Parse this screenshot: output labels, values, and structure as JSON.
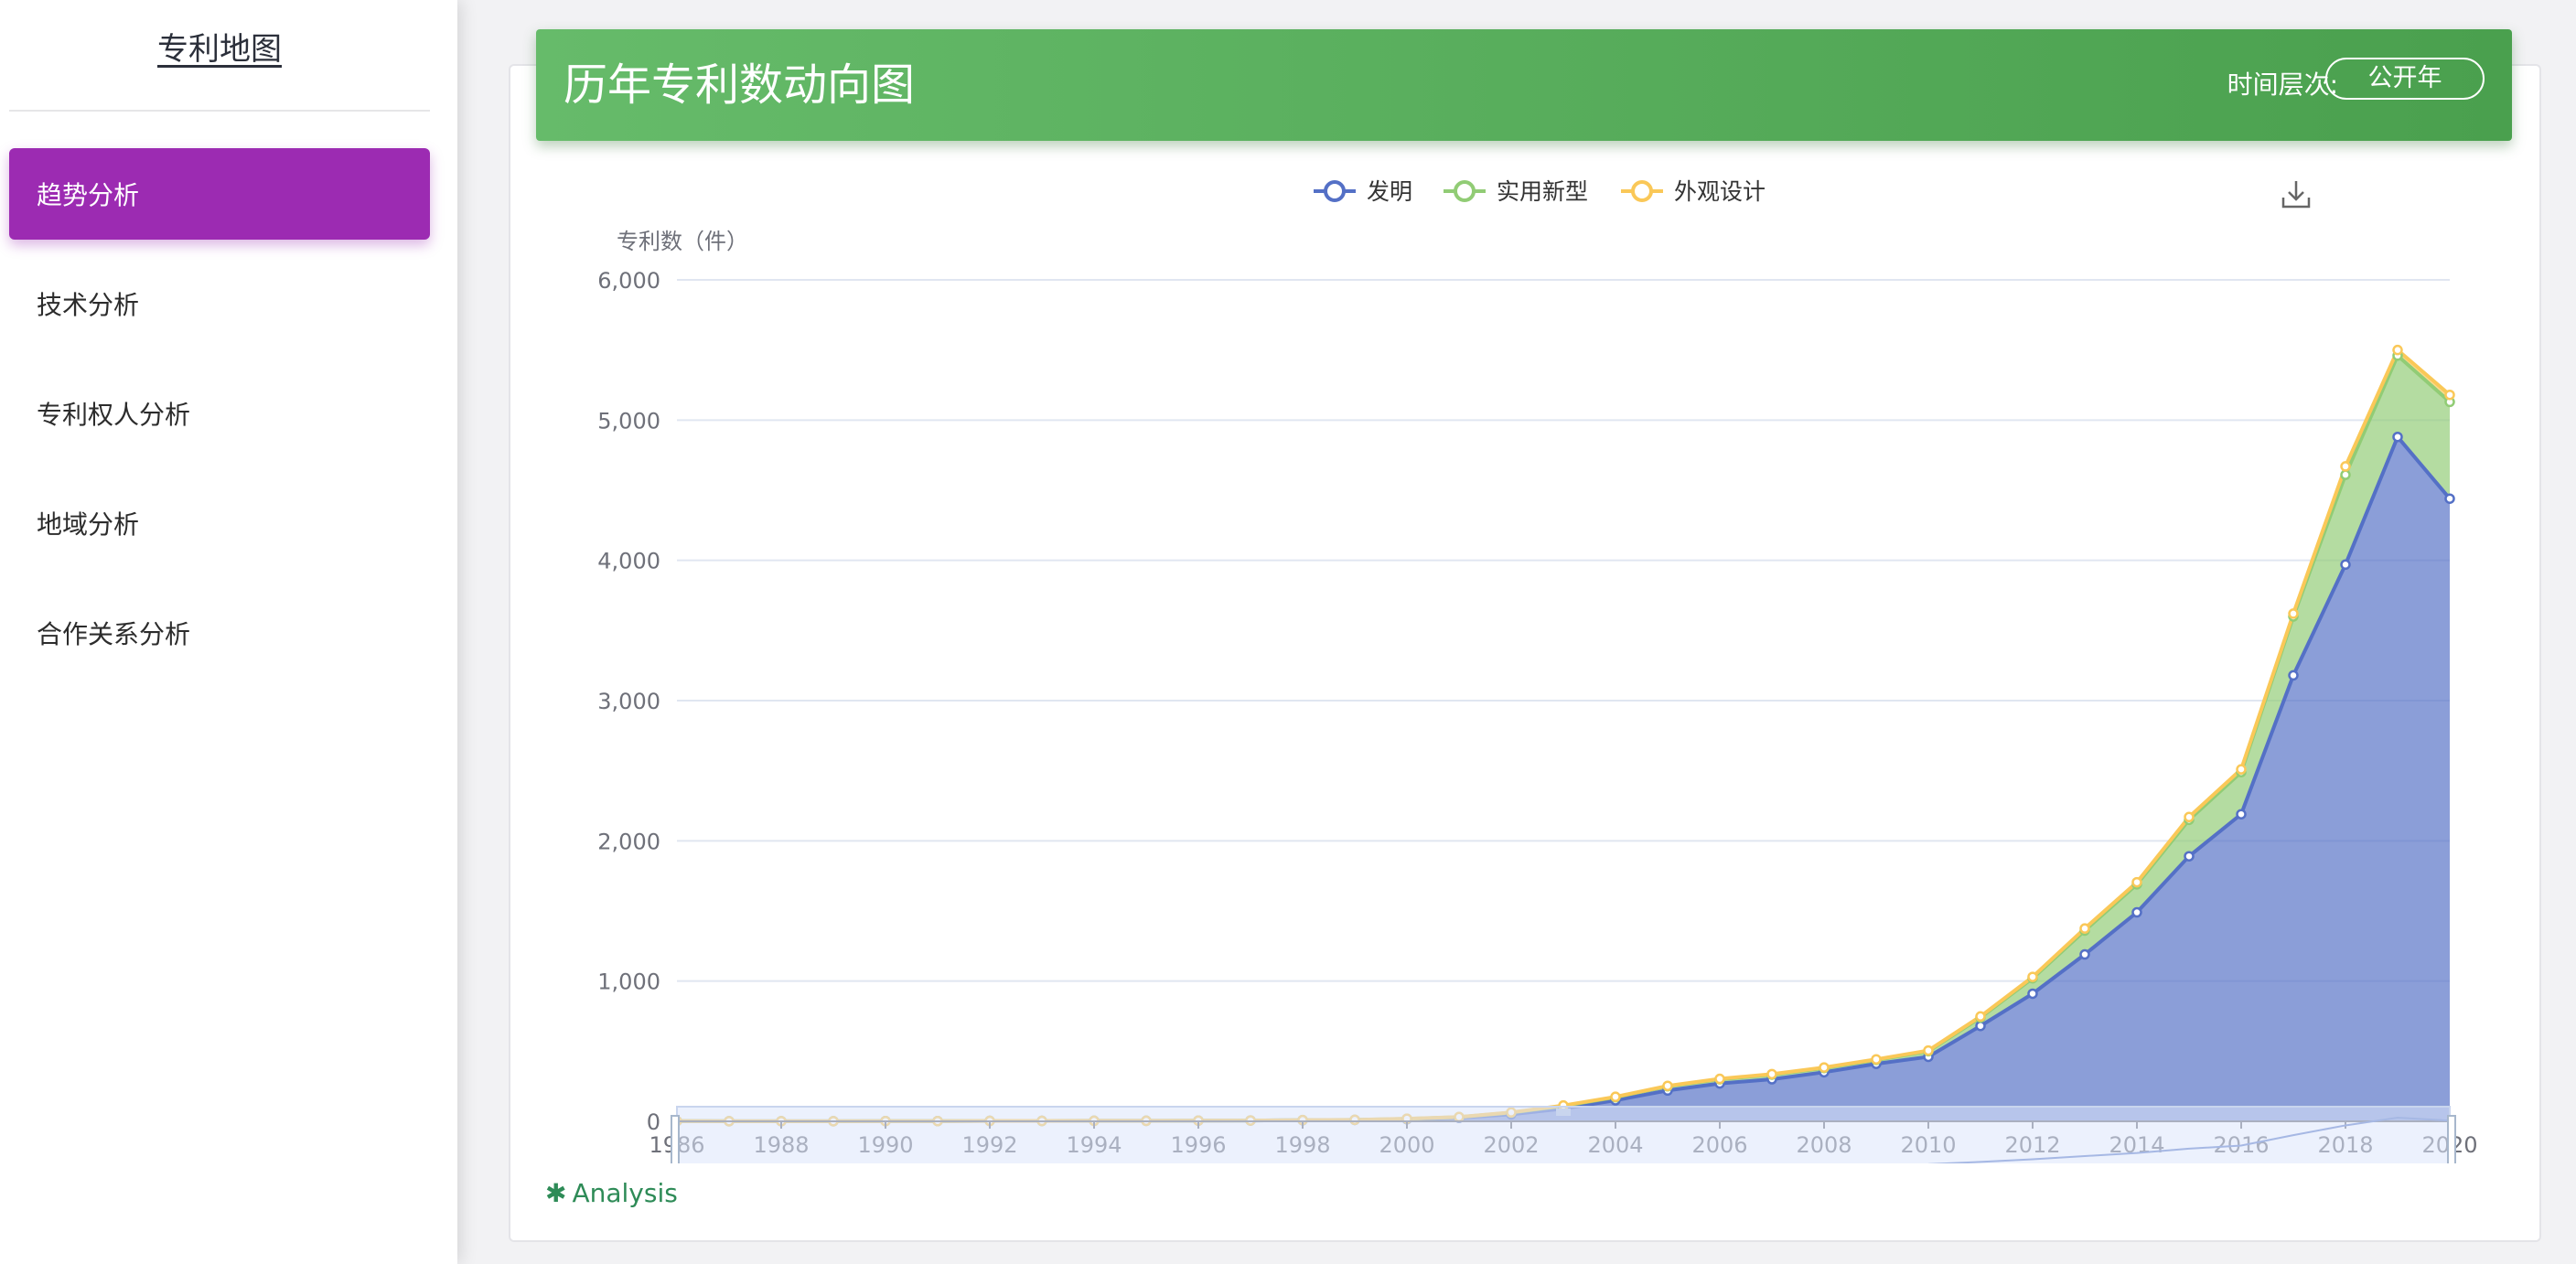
{
  "sidebar": {
    "title": "专利地图",
    "items": [
      {
        "label": "趋势分析",
        "active": true
      },
      {
        "label": "技术分析",
        "active": false
      },
      {
        "label": "专利权人分析",
        "active": false
      },
      {
        "label": "地域分析",
        "active": false
      },
      {
        "label": "合作关系分析",
        "active": false
      }
    ]
  },
  "header": {
    "title": "历年专利数动向图",
    "time_level_label": "时间层次:",
    "time_level_value": "公开年"
  },
  "analysis_link": {
    "icon": "asterisk-icon",
    "label": "Analysis"
  },
  "toolbox": {
    "download_icon": "download-icon"
  },
  "colors": {
    "accent_purple": "#9c2bb2",
    "header_green": "#5cb360",
    "invention": "#5470c6",
    "utility": "#91cc75",
    "design": "#fac858",
    "analysis_text": "#2e8b57"
  },
  "chart_data": {
    "type": "area",
    "stacked": true,
    "ylabel": "专利数（件）",
    "xlabel": "",
    "ylim": [
      0,
      6000
    ],
    "yticks": [
      0,
      1000,
      2000,
      3000,
      4000,
      5000,
      6000
    ],
    "ytick_labels": [
      "0",
      "1,000",
      "2,000",
      "3,000",
      "4,000",
      "5,000",
      "6,000"
    ],
    "x": [
      1986,
      1987,
      1988,
      1989,
      1990,
      1991,
      1992,
      1993,
      1994,
      1995,
      1996,
      1997,
      1998,
      1999,
      2000,
      2001,
      2002,
      2003,
      2004,
      2005,
      2006,
      2007,
      2008,
      2009,
      2010,
      2011,
      2012,
      2013,
      2014,
      2015,
      2016,
      2017,
      2018,
      2019,
      2020
    ],
    "xtick_labels": [
      "1986",
      "1988",
      "1990",
      "1992",
      "1994",
      "1996",
      "1998",
      "2000",
      "2002",
      "2004",
      "2006",
      "2008",
      "2010",
      "2012",
      "2014",
      "2016",
      "2018",
      "2020"
    ],
    "legend_position": "top-center",
    "grid": true,
    "series": [
      {
        "name": "发明",
        "color": "#5470c6",
        "values": [
          2,
          1,
          1,
          1,
          2,
          2,
          3,
          3,
          4,
          4,
          5,
          6,
          8,
          10,
          15,
          25,
          50,
          90,
          150,
          220,
          270,
          300,
          350,
          410,
          460,
          680,
          910,
          1190,
          1490,
          1890,
          2190,
          3180,
          3970,
          4880,
          4440
        ]
      },
      {
        "name": "实用新型",
        "color": "#91cc75",
        "values": [
          0,
          0,
          0,
          0,
          0,
          0,
          0,
          0,
          0,
          0,
          0,
          0,
          1,
          1,
          3,
          5,
          12,
          20,
          22,
          30,
          30,
          33,
          30,
          28,
          40,
          60,
          110,
          170,
          200,
          260,
          300,
          420,
          640,
          580,
          690
        ]
      },
      {
        "name": "外观设计",
        "color": "#fac858",
        "values": [
          0,
          0,
          0,
          0,
          0,
          0,
          0,
          0,
          0,
          0,
          0,
          0,
          0,
          0,
          1,
          1,
          2,
          3,
          3,
          3,
          3,
          4,
          4,
          4,
          5,
          8,
          10,
          15,
          15,
          20,
          20,
          20,
          60,
          40,
          50
        ]
      }
    ],
    "datazoom": {
      "start_label": "1986",
      "end_label": "2020",
      "range_percent": [
        0,
        100
      ]
    }
  }
}
